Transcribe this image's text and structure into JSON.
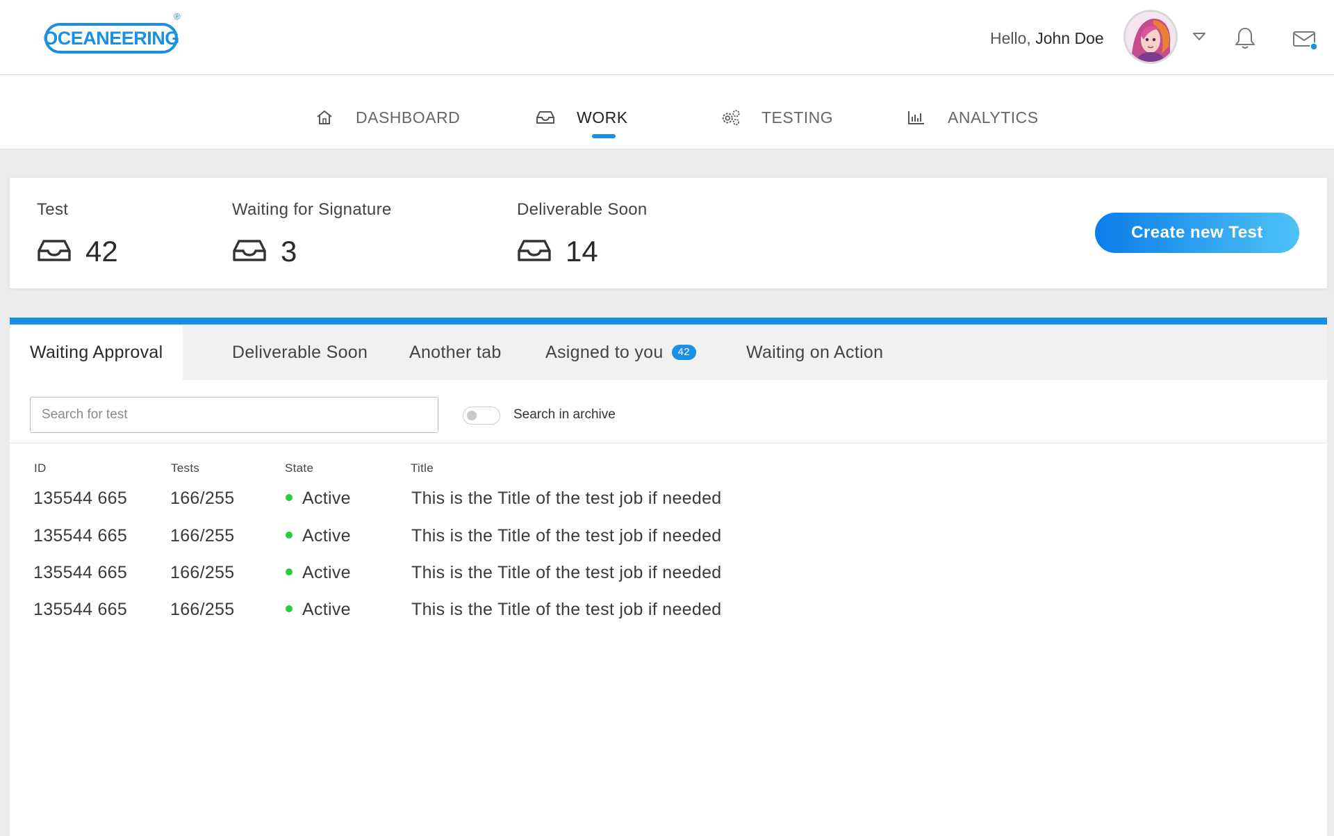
{
  "header": {
    "logo_text": "OCEANEERING",
    "logo_mark": "®",
    "greeting": "Hello,",
    "user_name": "John Doe",
    "icons": [
      "chevron-down-icon",
      "bell-icon",
      "mail-icon"
    ],
    "accent_color": "#1a8fe6"
  },
  "nav": {
    "items": [
      {
        "label": "DASHBOARD",
        "icon": "home-icon"
      },
      {
        "label": "WORK",
        "icon": "inbox-icon",
        "active": true
      },
      {
        "label": "TESTING",
        "icon": "gears-icon"
      },
      {
        "label": "ANALYTICS",
        "icon": "bar-chart-icon"
      }
    ]
  },
  "summary": {
    "stats": [
      {
        "label": "Test",
        "value": "42",
        "icon": "inbox-icon"
      },
      {
        "label": "Waiting for Signature",
        "value": "3",
        "icon": "inbox-icon"
      },
      {
        "label": "Deliverable Soon",
        "value": "14",
        "icon": "inbox-icon"
      }
    ],
    "create_button": "Create new Test"
  },
  "tabs": [
    {
      "label": "Waiting Approval",
      "active": true
    },
    {
      "label": "Deliverable Soon"
    },
    {
      "label": "Another tab"
    },
    {
      "label": "Asigned to you",
      "badge": "42"
    },
    {
      "label": "Waiting on Action"
    }
  ],
  "search": {
    "placeholder": "Search for test",
    "value": "",
    "archive_toggle_label": "Search in archive",
    "archive_toggle_on": false
  },
  "table": {
    "columns": [
      "ID",
      "Tests",
      "State",
      "Title"
    ],
    "rows": [
      {
        "id": "135544 665",
        "tests": "166/255",
        "state": "Active",
        "title": "This is the Title of the test job if needed"
      },
      {
        "id": "135544 665",
        "tests": "166/255",
        "state": "Active",
        "title": "This is the Title of the test job if needed"
      },
      {
        "id": "135544 665",
        "tests": "166/255",
        "state": "Active",
        "title": "This is the Title of the test job if needed"
      },
      {
        "id": "135544 665",
        "tests": "166/255",
        "state": "Active",
        "title": "This is the Title of the test job if needed"
      }
    ],
    "state_color": "#22d03c"
  }
}
